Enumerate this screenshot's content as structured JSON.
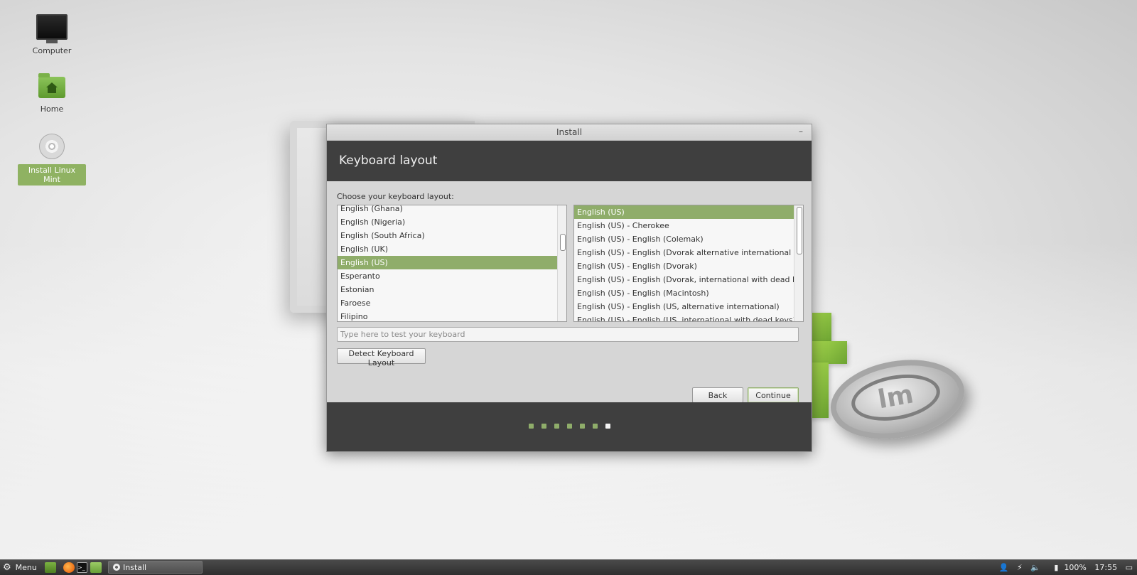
{
  "desktop": {
    "icons": [
      {
        "label": "Computer"
      },
      {
        "label": "Home"
      },
      {
        "label": "Install Linux Mint"
      }
    ]
  },
  "window": {
    "title": "Install",
    "minimize_glyph": "–",
    "header": "Keyboard layout",
    "choose_label": "Choose your keyboard layout:",
    "layouts": [
      "English (Ghana)",
      "English (Nigeria)",
      "English (South Africa)",
      "English (UK)",
      "English (US)",
      "Esperanto",
      "Estonian",
      "Faroese",
      "Filipino"
    ],
    "selected_layout": "English (US)",
    "variants": [
      "English (US)",
      "English (US) - Cherokee",
      "English (US) - English (Colemak)",
      "English (US) - English (Dvorak alternative international no dead keys)",
      "English (US) - English (Dvorak)",
      "English (US) - English (Dvorak, international with dead keys)",
      "English (US) - English (Macintosh)",
      "English (US) - English (US, alternative international)",
      "English (US) - English (US, international with dead keys)"
    ],
    "selected_variant": "English (US)",
    "test_placeholder": "Type here to test your keyboard",
    "detect_button": "Detect Keyboard Layout",
    "back_button": "Back",
    "continue_button": "Continue",
    "progress": {
      "total_steps": 7,
      "current_step": 7
    }
  },
  "taskbar": {
    "menu_label": "Menu",
    "task_label": "Install",
    "battery": "100%",
    "clock": "17:55"
  },
  "colors": {
    "accent": "#8fad6a",
    "dark_band": "#3f3f3f"
  }
}
